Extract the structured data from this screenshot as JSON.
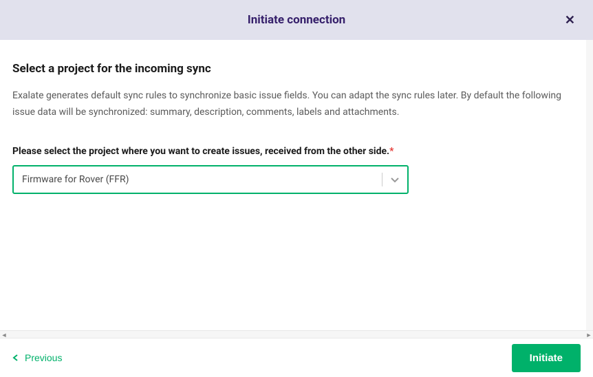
{
  "header": {
    "title": "Initiate connection"
  },
  "main": {
    "section_title": "Select a project for the incoming sync",
    "description": "Exalate generates default sync rules to synchronize basic issue fields. You can adapt the sync rules later. By default the following issue data will be synchronized: summary, description, comments, labels and attachments.",
    "field_label": "Please select the project where you want to create issues, received from the other side.",
    "required_marker": "*",
    "project_select": {
      "value": "Firmware for Rover (FFR)"
    }
  },
  "footer": {
    "previous_label": "Previous",
    "initiate_label": "Initiate"
  }
}
